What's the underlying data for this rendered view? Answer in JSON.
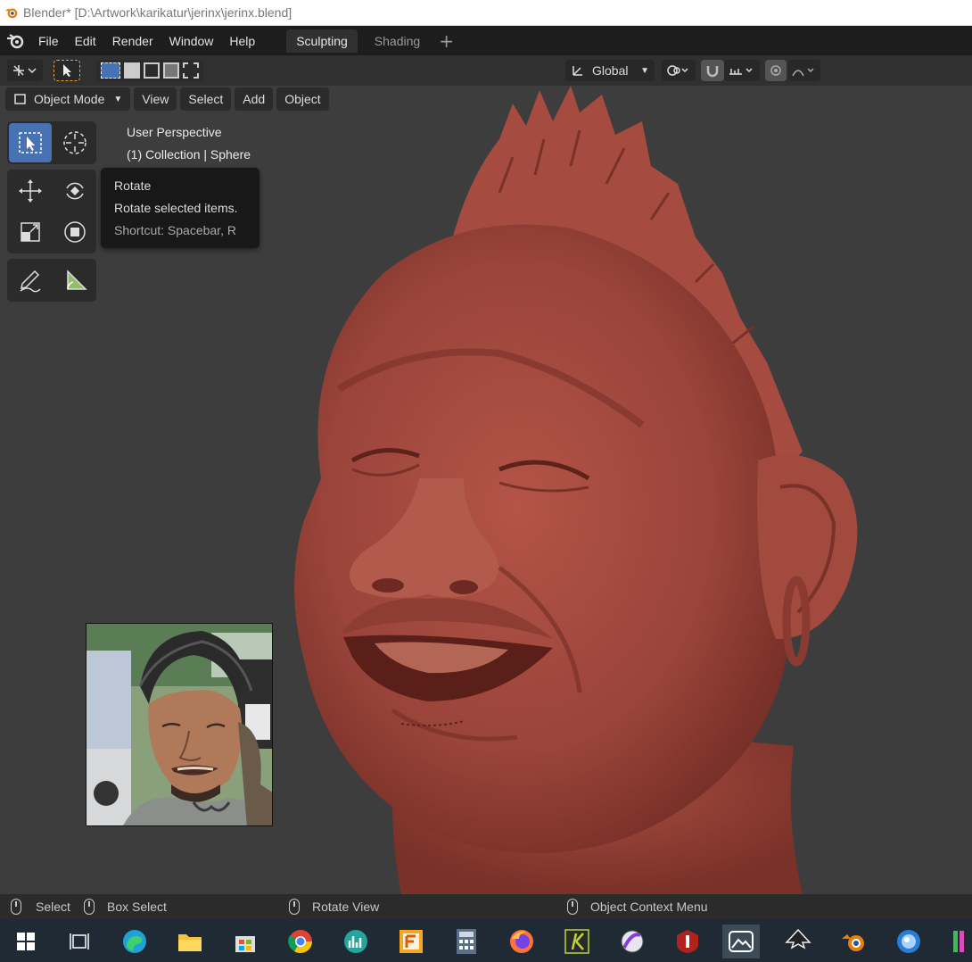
{
  "window": {
    "title": "Blender* [D:\\Artwork\\karikatur\\jerinx\\jerinx.blend]"
  },
  "menubar": {
    "items": [
      "File",
      "Edit",
      "Render",
      "Window",
      "Help"
    ],
    "tabs": [
      "Sculpting",
      "Shading"
    ],
    "active_tab": "Sculpting",
    "add_tab": "+"
  },
  "toolheader": {
    "orientation": "Global"
  },
  "viewport_header": {
    "mode": "Object Mode",
    "menus": [
      "View",
      "Select",
      "Add",
      "Object"
    ]
  },
  "viewport_info": {
    "line1": "User Perspective",
    "line2": "(1) Collection | Sphere"
  },
  "tooltip": {
    "title": "Rotate",
    "description": "Rotate selected items.",
    "shortcut": "Shortcut: Spacebar, R"
  },
  "toolbar": {
    "tools": [
      "select-box",
      "cursor",
      "move",
      "rotate",
      "scale",
      "transform",
      "annotate",
      "measure"
    ],
    "active": "select-box"
  },
  "statusbar": {
    "left": "Select",
    "left2": "Box Select",
    "middle": "Rotate View",
    "right": "Object Context Menu"
  },
  "taskbar": {
    "apps": [
      "start",
      "task-view",
      "edge",
      "file-explorer",
      "store",
      "chrome",
      "app-graph",
      "f-app",
      "calculator",
      "firefox",
      "app-k",
      "app-sphere",
      "app-red",
      "photos",
      "inkscape",
      "blender",
      "app-blue",
      "app-green"
    ],
    "active": "photos"
  },
  "colors": {
    "accent": "#4772b3",
    "sculpt": "#9a443a",
    "viewport_bg": "#3d3d3d"
  }
}
